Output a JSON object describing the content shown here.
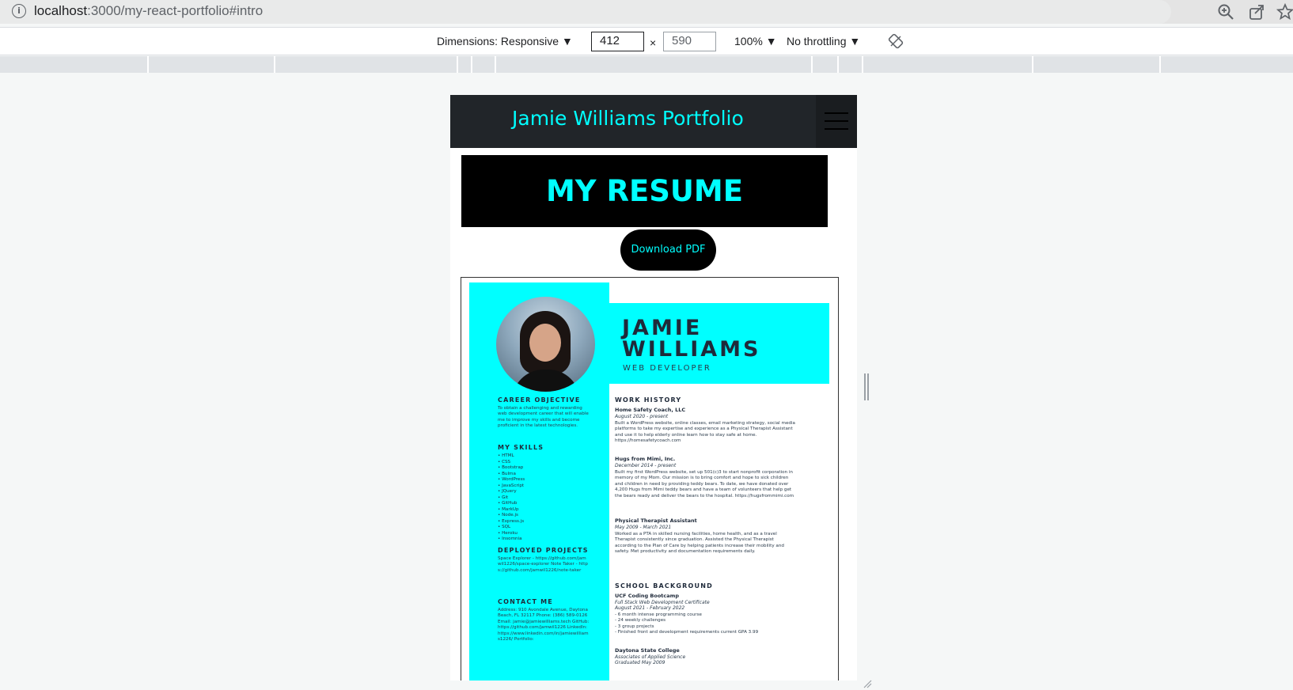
{
  "browser": {
    "url_host": "localhost",
    "url_rest": ":3000/my-react-portfolio#intro"
  },
  "devtools": {
    "dimensions_label": "Dimensions: Responsive ▼",
    "width": "412",
    "times": "×",
    "height": "590",
    "zoom": "100% ▼",
    "throttling": "No throttling ▼"
  },
  "navbar": {
    "brand": "Jamie Williams Portfolio"
  },
  "resume": {
    "heading": "MY RESUME",
    "download_label": "Download PDF",
    "name_line1": "JAMIE",
    "name_line2": "WILLIAMS",
    "role": "WEB DEVELOPER",
    "career_heading": "CAREER OBJECTIVE",
    "career_text": "To obtain a challenging and rewarding web development career that will enable me to improve my skills and become proficient in the latest technologies.",
    "skills_heading": "MY SKILLS",
    "skills": [
      "HTML",
      "CSS",
      "Bootstrap",
      "Bulma",
      "WordPress",
      "JavaScript",
      "JQuery",
      "Git",
      "GitHub",
      "MarkUp",
      "Node.js",
      "Express.js",
      "SQL",
      "Heroku",
      "Insomnia"
    ],
    "projects_heading": "DEPLOYED PROJECTS",
    "projects_text": "Space Explorer - https://github.com/jamwil1226/space-explorer Note Taker - https://github.com/jamwil1226/note-taker",
    "contact_heading": "CONTACT ME",
    "contact_text": "Address: 910 Avondale Avenue, Daytona Beach, FL 32117 Phone: (386) 589-0126 Email: jamie@jamiewilliams.tech GitHub: https://github.com/jamwil1226 LinkedIn: https://www.linkedin.com/in/jamiewilliams1226/ Portfolio:",
    "work_heading": "WORK HISTORY",
    "job1_title": "Home Safety Coach, LLC",
    "job1_dates": "August 2020 - present",
    "job1_text": "Built a WordPress website, online classes, email marketing strategy, social media platforms to take my expertise and experience as a Physical Therapist Assistant and use it to help elderly online learn how to stay safe at home. https://homesafetycoach.com",
    "job2_title": "Hugs from Mimi, Inc.",
    "job2_dates": "December 2014 - present",
    "job2_text": "Built my first WordPress website, set up 501(c)3 to start nonprofit corporation in memory of my Mom. Our mission is to bring comfort and hope to sick children and children in need by providing teddy bears. To date, we have donated over 4,200 Hugs from Mimi teddy bears and have a team of volunteers that help get the bears ready and deliver the bears to the hospital. https://hugsfrommimi.com",
    "job3_title": "Physical Therapist Assistant",
    "job3_dates": "May 2009 - March 2021",
    "job3_text": "Worked as a PTA in skilled nursing facilities, home health, and as a travel Therapist consistently since graduation. Assisted the Physical Therapist according to the Plan of Care by helping patients increase their mobility and safety. Met productivity and documentation requirements daily.",
    "school_heading": "SCHOOL BACKGROUND",
    "school1_title": "UCF Coding Bootcamp",
    "school1_cert": "Full Stack Web Development Certificate",
    "school1_dates": "August 2021 - February 2022",
    "school1_points": [
      "- 6 month intense programming course",
      "- 24 weekly challenges",
      "- 3 group projects",
      "- Finished front and development requirements current GPA 3.99"
    ],
    "school2_title": "Daytona State College",
    "school2_cert": "Associates of Applied Science",
    "school2_dates": "Graduated May 2009"
  }
}
